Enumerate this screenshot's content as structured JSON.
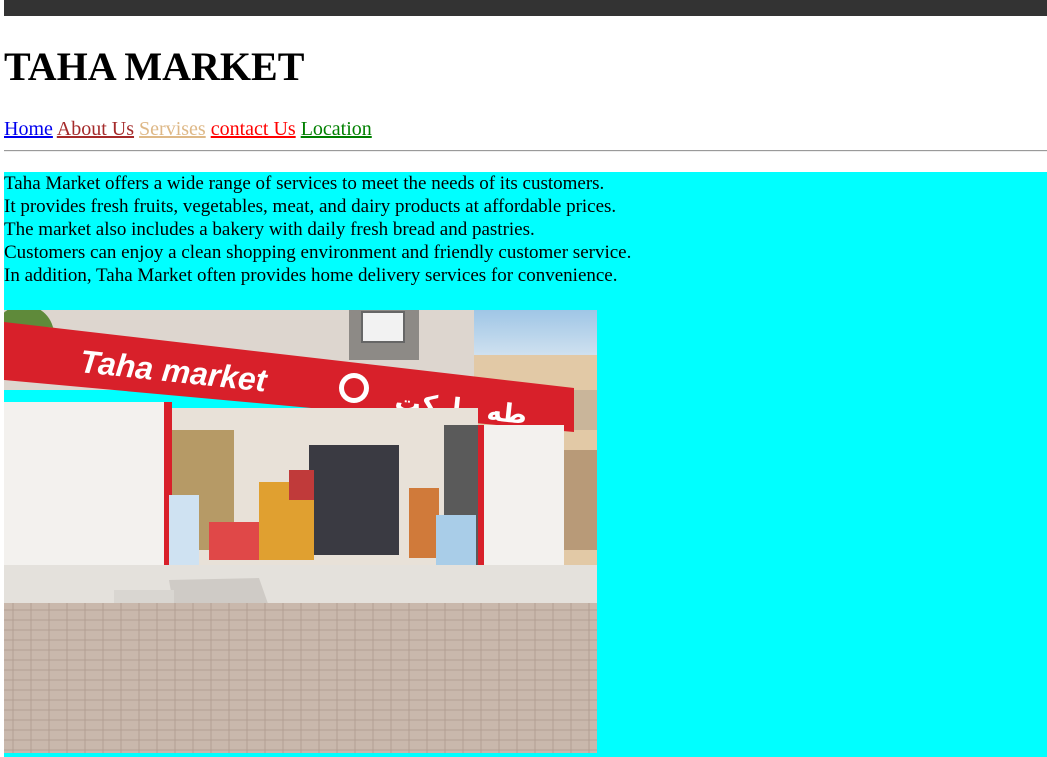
{
  "page": {
    "title": "TAHA MARKET"
  },
  "nav": [
    {
      "label": "Home",
      "color": "#0000ee"
    },
    {
      "label": "About Us",
      "color": "#a52a2a"
    },
    {
      "label": "Servises",
      "color": "#deb887"
    },
    {
      "label": "contact Us",
      "color": "#ff0000"
    },
    {
      "label": "Location",
      "color": "#008000"
    }
  ],
  "content": {
    "background": "#00ffff",
    "lines": [
      "Taha Market offers a wide range of services to meet the needs of its customers.",
      "It provides fresh fruits, vegetables, meat, and dairy products at affordable prices.",
      "The market also includes a bakery with daily fresh bread and pastries.",
      "Customers can enjoy a clean shopping environment and friendly customer service.",
      "In addition, Taha Market often provides home delivery services for convenience."
    ]
  },
  "photo": {
    "sign_text_latin": "Taha market",
    "sign_text_arabic": "طه ماركت"
  }
}
